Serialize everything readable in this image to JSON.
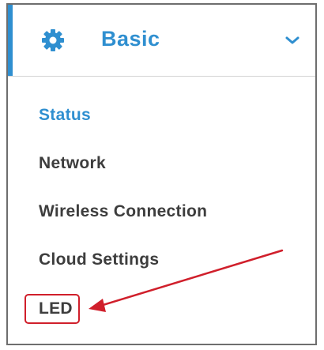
{
  "header": {
    "title": "Basic",
    "icon": "gear-icon",
    "expand_icon": "chevron-down-icon",
    "accent_color": "#2f8fd0"
  },
  "menu": {
    "items": [
      {
        "label": "Status",
        "active": true
      },
      {
        "label": "Network",
        "active": false
      },
      {
        "label": "Wireless Connection",
        "active": false
      },
      {
        "label": "Cloud Settings",
        "active": false
      },
      {
        "label": "LED",
        "active": false
      }
    ]
  },
  "annotation": {
    "highlight_color": "#d01f2b"
  }
}
